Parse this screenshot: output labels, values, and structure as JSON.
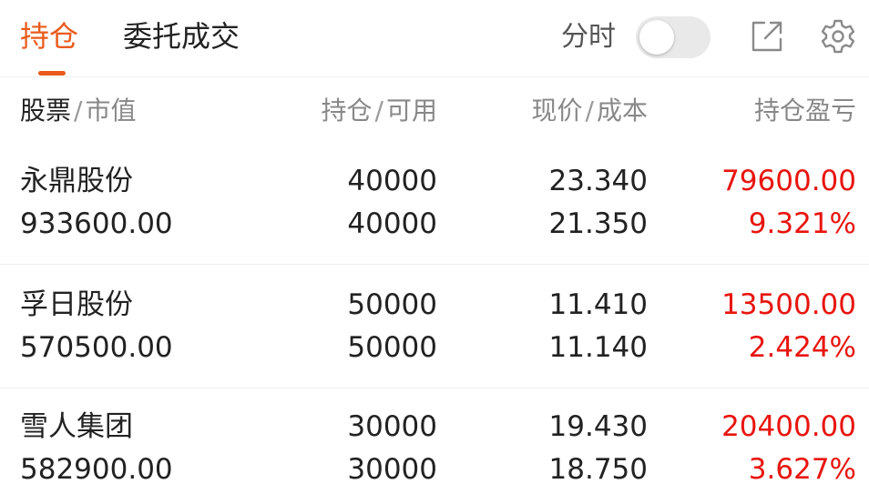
{
  "tabs": {
    "holdings": "持仓",
    "orders": "委托成交"
  },
  "toolbar": {
    "fenshi_label": "分时",
    "fenshi_enabled": false,
    "export_icon": "external-link-icon",
    "settings_icon": "gear-icon"
  },
  "colors": {
    "accent": "#ea5b1b",
    "profit": "#e8150f"
  },
  "columns": {
    "name": {
      "main": "股票",
      "sep": "/",
      "sub": "市值"
    },
    "position": {
      "main": "持仓",
      "sep": "/",
      "sub": "可用"
    },
    "price": {
      "main": "现价",
      "sep": "/",
      "sub": "成本"
    },
    "pl": {
      "main": "持仓盈亏"
    }
  },
  "holdings": [
    {
      "name": "永鼎股份",
      "market_value": "933600.00",
      "position": "40000",
      "available": "40000",
      "price": "23.340",
      "cost": "21.350",
      "pl_amount": "79600.00",
      "pl_percent": "9.321%"
    },
    {
      "name": "孚日股份",
      "market_value": "570500.00",
      "position": "50000",
      "available": "50000",
      "price": "11.410",
      "cost": "11.140",
      "pl_amount": "13500.00",
      "pl_percent": "2.424%"
    },
    {
      "name": "雪人集团",
      "market_value": "582900.00",
      "position": "30000",
      "available": "30000",
      "price": "19.430",
      "cost": "18.750",
      "pl_amount": "20400.00",
      "pl_percent": "3.627%"
    }
  ]
}
